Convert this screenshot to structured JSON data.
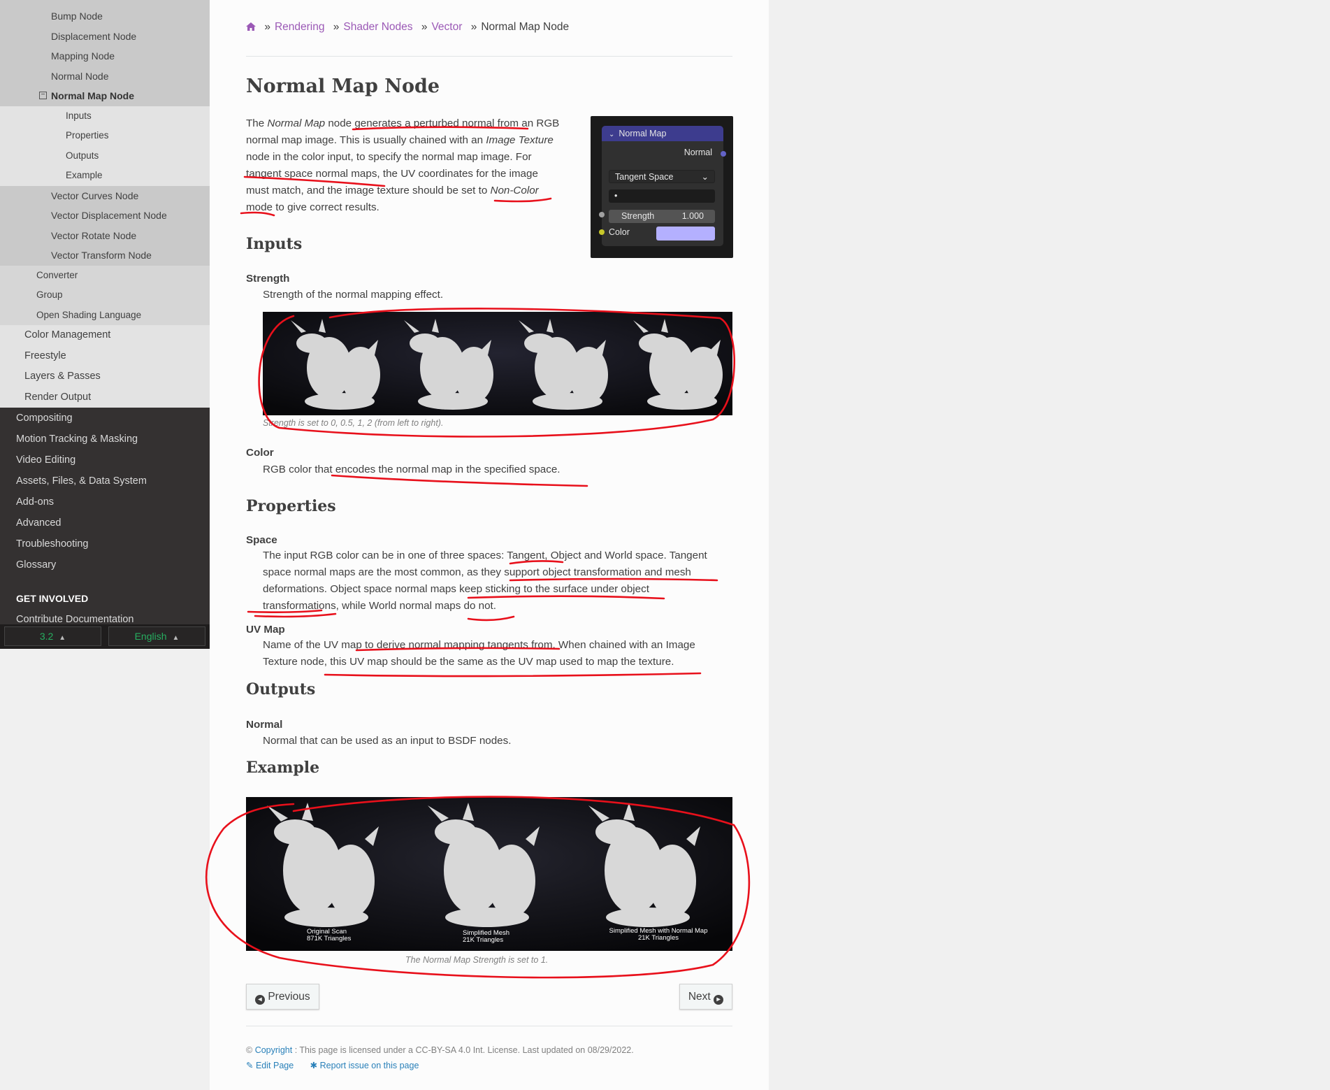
{
  "sidebar": {
    "items_l3_top": [
      "Bump Node",
      "Displacement Node",
      "Mapping Node",
      "Normal Node"
    ],
    "current": "Normal Map Node",
    "current_box": "−",
    "items_l4": [
      "Inputs",
      "Properties",
      "Outputs",
      "Example"
    ],
    "items_l3_bottom": [
      "Vector Curves Node",
      "Vector Displacement Node",
      "Vector Rotate Node",
      "Vector Transform Node"
    ],
    "items_l2": [
      "Converter",
      "Group",
      "Open Shading Language"
    ],
    "items_l1": [
      "Color Management",
      "Freestyle",
      "Layers & Passes",
      "Render Output"
    ],
    "items_l0": [
      "Compositing",
      "Motion Tracking & Masking",
      "Video Editing",
      "Assets, Files, & Data System",
      "Add-ons",
      "Advanced",
      "Troubleshooting",
      "Glossary"
    ],
    "caption": "GET INVOLVED",
    "contribute": "Contribute Documentation",
    "version": "3.2",
    "language": "English"
  },
  "breadcrumb": {
    "items": [
      "Rendering",
      "Shader Nodes",
      "Vector"
    ],
    "current": "Normal Map Node",
    "sep": "»"
  },
  "page": {
    "title": "Normal Map Node",
    "intro_lines": [
      [
        "The ",
        "Normal Map",
        " node generates a perturbed normal from an RGB"
      ],
      [
        "normal map image. This is usually chained with an ",
        "Image Texture",
        ""
      ],
      [
        "node in the color input, to specify the normal map image. For",
        "",
        ""
      ],
      [
        "tangent space normal maps, the UV coordinates for the image",
        "",
        ""
      ],
      [
        "must match, and the image texture should be set to ",
        "Non-Color",
        ""
      ],
      [
        "mode to give correct results.",
        "",
        ""
      ]
    ],
    "node": {
      "header": "Normal Map",
      "output": "Normal",
      "space": "Tangent Space",
      "uvmap": "•",
      "strength_label": "Strength",
      "strength_value": "1.000",
      "color_label": "Color",
      "color_swatch": "#b4b0ff"
    },
    "inputs_heading": "Inputs",
    "strength_term": "Strength",
    "strength_def": "Strength of the normal mapping effect.",
    "strength_caption": "Strength is set to 0, 0.5, 1, 2 (from left to right).",
    "color_term": "Color",
    "color_def": "RGB color that encodes the normal map in the specified space.",
    "properties_heading": "Properties",
    "space_term": "Space",
    "space_lines": [
      "The input RGB color can be in one of three spaces: Tangent, Object and World space. Tangent",
      "space normal maps are the most common, as they support object transformation and mesh",
      "deformations. Object space normal maps keep sticking to the surface under object",
      "transformations, while World normal maps do not."
    ],
    "uvmap_term": "UV Map",
    "uvmap_lines": [
      "Name of the UV map to derive normal mapping tangents from. When chained with an Image",
      "Texture node, this UV map should be the same as the UV map used to map the texture."
    ],
    "outputs_heading": "Outputs",
    "normal_term": "Normal",
    "normal_def": "Normal that can be used as an input to BSDF nodes.",
    "example_heading": "Example",
    "example_labels": [
      [
        "Original Scan",
        "871K Triangles"
      ],
      [
        "Simplified Mesh",
        "21K Triangles"
      ],
      [
        "Simplified Mesh with Normal Map",
        "21K Triangles"
      ]
    ],
    "example_caption": "The Normal Map Strength is set to 1.",
    "prev": "Previous",
    "next": "Next"
  },
  "footer": {
    "copyright_symbol": "©",
    "copyright_link": "Copyright",
    "license": ": This page is licensed under a CC-BY-SA 4.0 Int. License. Last updated on 08/29/2022.",
    "edit": "Edit Page",
    "report": "Report issue on this page"
  },
  "colors": {
    "link": "#2980b9",
    "breadcrumb_link": "#9b59b6",
    "sidebar_dark": "#343131",
    "version_green": "#27ae60",
    "annotation_red": "#e8101b"
  }
}
